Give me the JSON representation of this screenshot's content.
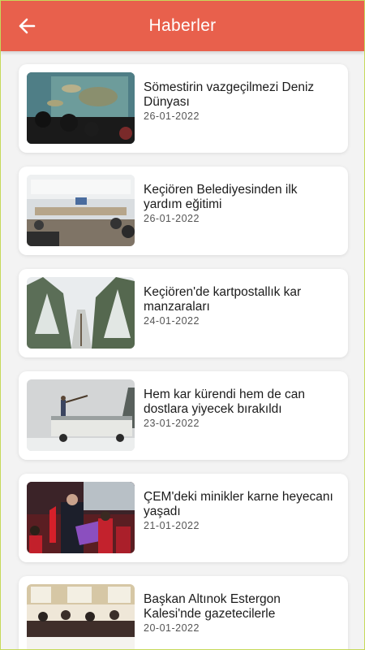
{
  "header": {
    "title": "Haberler",
    "back_icon": "arrow-left-icon",
    "background": "#e8604c"
  },
  "news": [
    {
      "title": "Sömestirin vazgeçilmezi Deniz Dünyası",
      "date": "26-01-2022",
      "image": "aquarium-photo"
    },
    {
      "title": "Keçiören Belediyesinden ilk yardım eğitimi",
      "date": "26-01-2022",
      "image": "meeting-room-photo"
    },
    {
      "title": "Keçiören'de kartpostallık kar manzaraları",
      "date": "24-01-2022",
      "image": "snowy-forest-photo"
    },
    {
      "title": "Hem kar kürendi hem de can dostlara yiyecek bırakıldı",
      "date": "23-01-2022",
      "image": "snow-truck-photo"
    },
    {
      "title": "ÇEM'deki minikler karne heyecanı yaşadı",
      "date": "21-01-2022",
      "image": "report-card-ceremony-photo"
    },
    {
      "title": "Başkan Altınok Estergon Kalesi'nde gazetecilerle",
      "date": "20-01-2022",
      "image": "press-meeting-photo"
    }
  ]
}
